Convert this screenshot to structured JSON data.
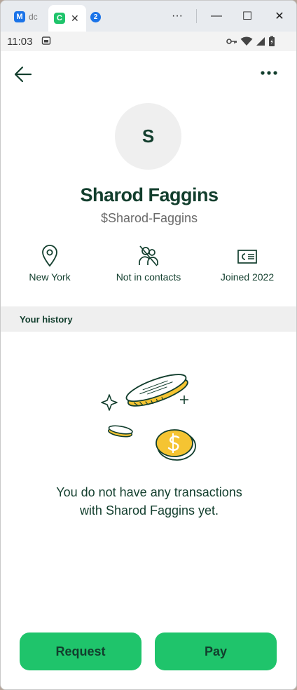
{
  "browser": {
    "tabs": [
      {
        "favicon": "M",
        "label": "dc"
      },
      {
        "favicon": "C",
        "close": "✕"
      },
      {
        "favicon": "2"
      }
    ],
    "controls": {
      "more": "···",
      "minimize": "—",
      "maximize": "☐",
      "close": "✕"
    }
  },
  "status_bar": {
    "time": "11:03"
  },
  "profile": {
    "avatar_initial": "S",
    "name": "Sharod Faggins",
    "handle": "$Sharod-Faggins",
    "info": [
      {
        "icon": "location-pin-icon",
        "label": "New York"
      },
      {
        "icon": "not-in-contacts-icon",
        "label": "Not in contacts"
      },
      {
        "icon": "id-card-icon",
        "label": "Joined 2022"
      }
    ]
  },
  "history": {
    "title": "Your history",
    "empty_line1": "You do not have any transactions",
    "empty_line2": "with Sharod Faggins yet."
  },
  "actions": {
    "request": "Request",
    "pay": "Pay"
  },
  "colors": {
    "brand_green": "#1fc46b",
    "text_dark": "#123e2d",
    "coin_yellow": "#f5c432"
  }
}
